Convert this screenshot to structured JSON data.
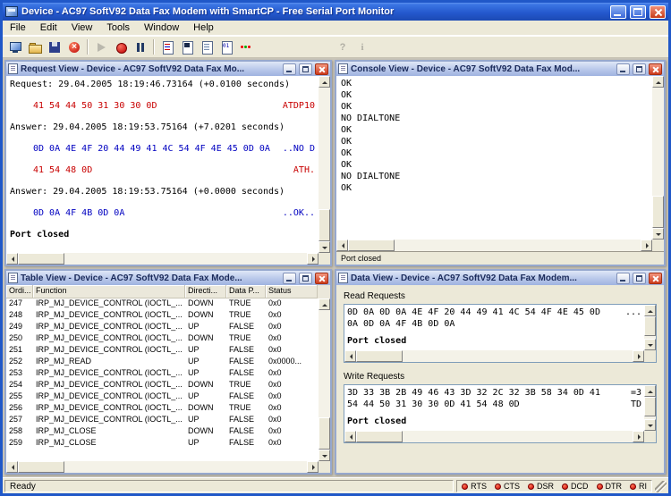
{
  "window": {
    "title": "Device - AC97 SoftV92 Data Fax Modem with SmartCP - Free Serial Port Monitor",
    "menu": [
      {
        "label": "File",
        "name": "menu-file"
      },
      {
        "label": "Edit",
        "name": "menu-edit"
      },
      {
        "label": "View",
        "name": "menu-view"
      },
      {
        "label": "Tools",
        "name": "menu-tools"
      },
      {
        "label": "Window",
        "name": "menu-window"
      },
      {
        "label": "Help",
        "name": "menu-help"
      }
    ]
  },
  "toolbar": {
    "items": [
      {
        "kind": "tbtn",
        "name": "new-session-button",
        "icon": "monitor-icon",
        "inter": "true"
      },
      {
        "kind": "tbtn",
        "name": "open-button",
        "icon": "open-folder-icon",
        "inter": "true"
      },
      {
        "kind": "tbtn",
        "name": "save-button",
        "icon": "save-icon",
        "inter": "true"
      },
      {
        "kind": "tbtn",
        "name": "close-session-button",
        "icon": "red-cross-icon",
        "inter": "true"
      },
      {
        "kind": "tsep",
        "name": "toolbar-separator",
        "icon": "sep",
        "inter": "false"
      },
      {
        "kind": "tbtn disabled",
        "name": "start-monitoring-button",
        "icon": "play-icon",
        "inter": "true"
      },
      {
        "kind": "tbtn",
        "name": "record-button",
        "icon": "record-icon",
        "inter": "true"
      },
      {
        "kind": "tbtn",
        "name": "pause-button",
        "icon": "pause-icon",
        "inter": "true"
      },
      {
        "kind": "tsep",
        "name": "toolbar-separator",
        "icon": "sep",
        "inter": "false"
      },
      {
        "kind": "tbtn",
        "name": "request-view-button",
        "icon": "request-view-icon",
        "inter": "true"
      },
      {
        "kind": "tbtn",
        "name": "console-view-button",
        "icon": "console-view-icon",
        "inter": "true"
      },
      {
        "kind": "tbtn",
        "name": "table-view-button",
        "icon": "table-view-icon",
        "inter": "true"
      },
      {
        "kind": "tbtn",
        "name": "data-view-button",
        "icon": "data-view-icon",
        "inter": "true"
      },
      {
        "kind": "tbtn",
        "name": "modem-lines-button",
        "icon": "modem-lines-icon",
        "inter": "true"
      },
      {
        "kind": "tgap",
        "name": "toolbar-gap",
        "icon": "gap",
        "inter": "false"
      },
      {
        "kind": "tbtn disabled",
        "name": "help-button",
        "icon": "help-icon",
        "inter": "true"
      },
      {
        "kind": "tbtn disabled",
        "name": "about-button",
        "icon": "info-icon",
        "inter": "true"
      }
    ]
  },
  "request_view": {
    "title": "Request View - Device - AC97 SoftV92 Data Fax Mo...",
    "lines": [
      {
        "cls": "info",
        "text": "Request: 29.04.2005 18:19:46.73164 (+0.0100 seconds)",
        "ascii": ""
      },
      {
        "cls": "tx",
        "text": "41 54 44 50 31 30 30 0D",
        "ascii": "ATDP10"
      },
      {
        "cls": "info",
        "text": "Answer: 29.04.2005 18:19:53.75164 (+7.0201 seconds)",
        "ascii": ""
      },
      {
        "cls": "rx",
        "text": "0D 0A 4E 4F 20 44 49 41 4C 54 4F 4E 45 0D 0A",
        "ascii": "..NO D"
      },
      {
        "cls": "tx",
        "text": "41 54 48 0D",
        "ascii": "ATH."
      },
      {
        "cls": "info",
        "text": "Answer: 29.04.2005 18:19:53.75164 (+0.0000 seconds)",
        "ascii": ""
      },
      {
        "cls": "rx",
        "text": "0D 0A 4F 4B 0D 0A",
        "ascii": "..OK.."
      },
      {
        "cls": "closed",
        "text": "Port closed",
        "ascii": ""
      }
    ]
  },
  "console_view": {
    "title": "Console View - Device - AC97 SoftV92 Data Fax Mod...",
    "lines": [
      "OK",
      "OK",
      "OK",
      "NO DIALTONE",
      "OK",
      "OK",
      "OK",
      "OK",
      "NO DIALTONE",
      "OK"
    ],
    "status": "Port closed"
  },
  "table_view": {
    "title": "Table View - Device - AC97 SoftV92 Data Fax Mode...",
    "columns": [
      {
        "label": "Ordi...",
        "name": "column-ordinal"
      },
      {
        "label": "Function",
        "name": "column-function"
      },
      {
        "label": "Directi...",
        "name": "column-direction"
      },
      {
        "label": "Data P...",
        "name": "column-data-present"
      },
      {
        "label": "Status",
        "name": "column-status"
      }
    ],
    "rows": [
      {
        "ord": "247",
        "function": "IRP_MJ_DEVICE_CONTROL (IOCTL_...",
        "direction": "DOWN",
        "data_present": "TRUE",
        "status": "0x0"
      },
      {
        "ord": "248",
        "function": "IRP_MJ_DEVICE_CONTROL (IOCTL_...",
        "direction": "DOWN",
        "data_present": "TRUE",
        "status": "0x0"
      },
      {
        "ord": "249",
        "function": "IRP_MJ_DEVICE_CONTROL (IOCTL_...",
        "direction": "UP",
        "data_present": "FALSE",
        "status": "0x0"
      },
      {
        "ord": "250",
        "function": "IRP_MJ_DEVICE_CONTROL (IOCTL_...",
        "direction": "DOWN",
        "data_present": "TRUE",
        "status": "0x0"
      },
      {
        "ord": "251",
        "function": "IRP_MJ_DEVICE_CONTROL (IOCTL_...",
        "direction": "UP",
        "data_present": "FALSE",
        "status": "0x0"
      },
      {
        "ord": "252",
        "function": "IRP_MJ_READ",
        "direction": "UP",
        "data_present": "FALSE",
        "status": "0x0000..."
      },
      {
        "ord": "253",
        "function": "IRP_MJ_DEVICE_CONTROL (IOCTL_...",
        "direction": "UP",
        "data_present": "FALSE",
        "status": "0x0"
      },
      {
        "ord": "254",
        "function": "IRP_MJ_DEVICE_CONTROL (IOCTL_...",
        "direction": "DOWN",
        "data_present": "TRUE",
        "status": "0x0"
      },
      {
        "ord": "255",
        "function": "IRP_MJ_DEVICE_CONTROL (IOCTL_...",
        "direction": "UP",
        "data_present": "FALSE",
        "status": "0x0"
      },
      {
        "ord": "256",
        "function": "IRP_MJ_DEVICE_CONTROL (IOCTL_...",
        "direction": "DOWN",
        "data_present": "TRUE",
        "status": "0x0"
      },
      {
        "ord": "257",
        "function": "IRP_MJ_DEVICE_CONTROL (IOCTL_...",
        "direction": "UP",
        "data_present": "FALSE",
        "status": "0x0"
      },
      {
        "ord": "258",
        "function": "IRP_MJ_CLOSE",
        "direction": "DOWN",
        "data_present": "FALSE",
        "status": "0x0"
      },
      {
        "ord": "259",
        "function": "IRP_MJ_CLOSE",
        "direction": "UP",
        "data_present": "FALSE",
        "status": "0x0"
      }
    ]
  },
  "data_view": {
    "title": "Data View - Device - AC97 SoftV92 Data Fax Modem...",
    "read_label": "Read Requests",
    "write_label": "Write Requests",
    "read_lines": [
      {
        "cls": "",
        "hex": "0D 0A 0D 0A 4E 4F 20 44 49 41 4C 54 4F 4E 45 0D",
        "ascii": "..."
      },
      {
        "cls": "",
        "hex": "0A 0D 0A 4F 4B 0D 0A",
        "ascii": ""
      },
      {
        "cls": "closedline",
        "hex": "Port closed",
        "ascii": ""
      }
    ],
    "write_lines": [
      {
        "cls": "",
        "hex": "3D 33 3B 2B 49 46 43 3D 32 2C 32 3B 58 34 0D 41",
        "ascii": "=3"
      },
      {
        "cls": "",
        "hex": "54 44 50 31 30 30 0D 41 54 48 0D",
        "ascii": "TD"
      },
      {
        "cls": "closedline",
        "hex": "Port closed",
        "ascii": ""
      }
    ]
  },
  "statusbar": {
    "ready": "Ready",
    "leds": [
      {
        "label": "RTS",
        "name": "rts-led"
      },
      {
        "label": "CTS",
        "name": "cts-led"
      },
      {
        "label": "DSR",
        "name": "dsr-led"
      },
      {
        "label": "DCD",
        "name": "dcd-led"
      },
      {
        "label": "DTR",
        "name": "dtr-led"
      },
      {
        "label": "RI",
        "name": "ri-led"
      }
    ]
  },
  "colors": {
    "titlebar": "#2559CE",
    "tx_hex": "#C80000",
    "rx_hex": "#0000C0",
    "led": "#CC0000",
    "close_button": "#CC3A1C"
  }
}
